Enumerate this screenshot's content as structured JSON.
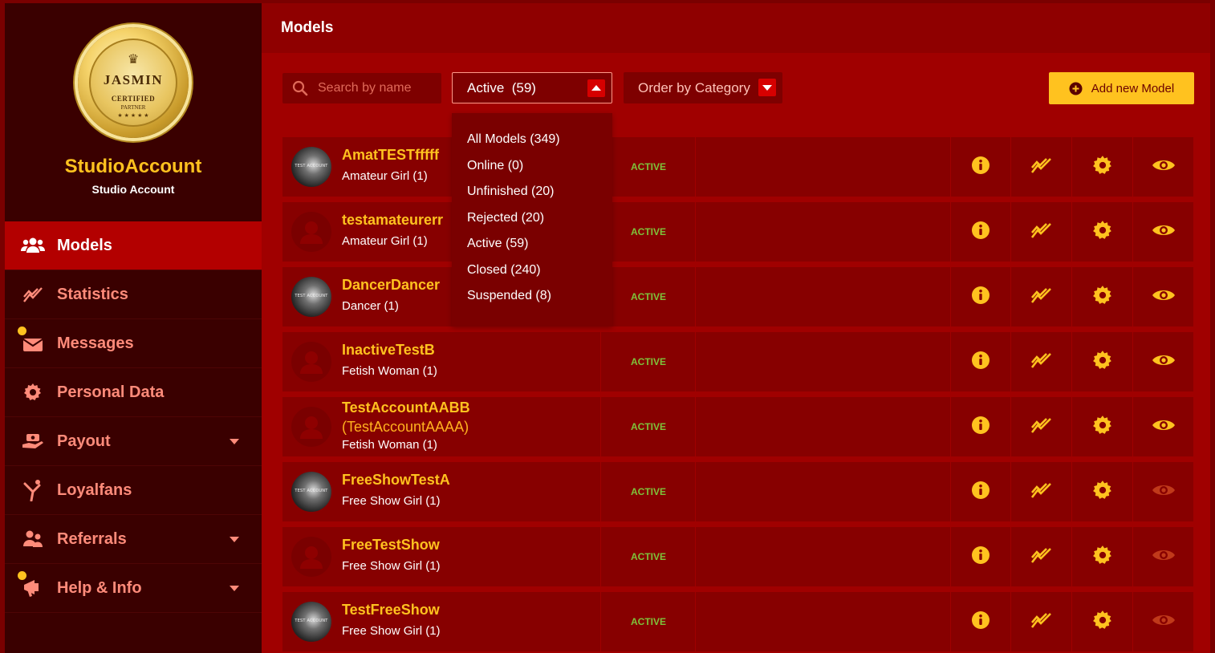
{
  "sidebar": {
    "badge": {
      "brand": "JASMIN",
      "line1": "CERTIFIED",
      "line2": "PARTNER"
    },
    "studio_name": "StudioAccount",
    "studio_subtitle": "Studio Account",
    "items": [
      {
        "label": "Models",
        "icon": "users-icon"
      },
      {
        "label": "Statistics",
        "icon": "chart-line-icon"
      },
      {
        "label": "Messages",
        "icon": "envelope-icon"
      },
      {
        "label": "Personal Data",
        "icon": "gear-icon"
      },
      {
        "label": "Payout",
        "icon": "money-hand-icon"
      },
      {
        "label": "Loyalfans",
        "icon": "loyalfans-icon"
      },
      {
        "label": "Referrals",
        "icon": "referrals-icon"
      },
      {
        "label": "Help & Info",
        "icon": "megaphone-icon"
      }
    ]
  },
  "main": {
    "title": "Models",
    "search_placeholder": "Search by name",
    "status_filter": "Active  (59)",
    "order_filter": "Order by Category",
    "add_button": "Add new Model"
  },
  "dropdown": {
    "options": [
      "All Models (349)",
      "Online (0)",
      "Unfinished (20)",
      "Rejected (20)",
      "Active (59)",
      "Closed (240)",
      "Suspended (8)"
    ]
  },
  "models": [
    {
      "name": "AmatTESTfffff",
      "alias": "",
      "category": "Amateur Girl (1)",
      "status": "ACTIVE",
      "avatar": "photo",
      "visible": true
    },
    {
      "name": "testamateurerr",
      "alias": "",
      "category": "Amateur Girl (1)",
      "status": "ACTIVE",
      "avatar": "placeholder",
      "visible": true
    },
    {
      "name": "DancerDancer",
      "alias": "",
      "category": "Dancer (1)",
      "status": "ACTIVE",
      "avatar": "photo",
      "visible": true
    },
    {
      "name": "InactiveTestB",
      "alias": "",
      "category": "Fetish Woman (1)",
      "status": "ACTIVE",
      "avatar": "placeholder",
      "visible": true
    },
    {
      "name": "TestAccountAABB",
      "alias": "(TestAccountAAAA)",
      "category": "Fetish Woman (1)",
      "status": "ACTIVE",
      "avatar": "placeholder",
      "visible": true
    },
    {
      "name": "FreeShowTestA",
      "alias": "",
      "category": "Free Show Girl (1)",
      "status": "ACTIVE",
      "avatar": "photo",
      "visible": false
    },
    {
      "name": "FreeTestShow",
      "alias": "",
      "category": "Free Show Girl (1)",
      "status": "ACTIVE",
      "avatar": "placeholder",
      "visible": false
    },
    {
      "name": "TestFreeShow",
      "alias": "",
      "category": "Free Show Girl (1)",
      "status": "ACTIVE",
      "avatar": "photo",
      "visible": false
    }
  ],
  "colors": {
    "accent": "#ffc21f",
    "active_status": "#7ec23a",
    "nav_text": "#ff8b7a",
    "eye_dim": "#c0391a"
  }
}
